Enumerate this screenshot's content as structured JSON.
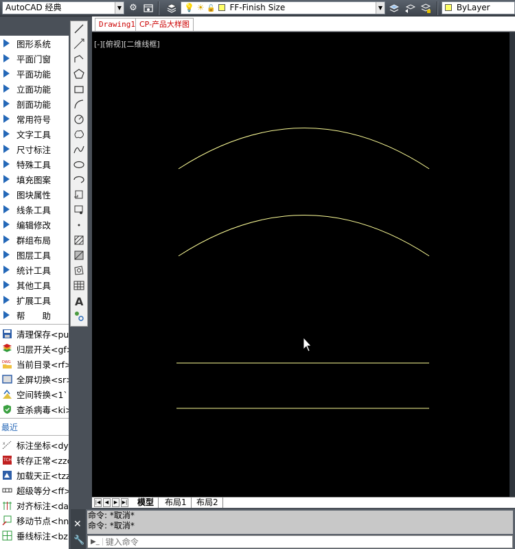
{
  "toolbar": {
    "workspace": "AutoCAD 经典",
    "layer": "FF-Finish Size",
    "color": "ByLayer",
    "icons": [
      "gear-icon",
      "workspace-icon",
      "layer-properties-icon",
      "lightbulb-icon",
      "sun-icon",
      "lock-icon",
      "make-current-layer-icon",
      "layer-previous-icon",
      "layer-state-icon"
    ]
  },
  "file_tabs": [
    {
      "label": "Drawing1",
      "active": false
    },
    {
      "label": "CP-产品大样图",
      "active": true
    }
  ],
  "viewport_label": "[-][俯视][二维线框]",
  "left_menu": [
    "图形系统",
    "平面门窗",
    "平面功能",
    "立面功能",
    "剖面功能",
    "常用符号",
    "文字工具",
    "尺寸标注",
    "特殊工具",
    "填充图案",
    "图块属性",
    "线条工具",
    "编辑修改",
    "群组布局",
    "图层工具",
    "统计工具",
    "其他工具",
    "扩展工具",
    "帮　　助"
  ],
  "tools_top": [
    {
      "label": "清理保存<pu>",
      "icon": "save-icon"
    },
    {
      "label": "归层开关<gf>",
      "icon": "layers-toggle-icon"
    },
    {
      "label": "当前目录<rf>",
      "icon": "dwg-folder-icon"
    },
    {
      "label": "全屏切换<sr>",
      "icon": "fullscreen-icon"
    },
    {
      "label": "空间转换<1`",
      "icon": "space-convert-icon"
    },
    {
      "label": "查杀病毒<ki>",
      "icon": "shield-icon"
    }
  ],
  "recent_label": "最近",
  "tools_recent": [
    {
      "label": "标注坐标<dy>",
      "icon": "coordinate-icon"
    },
    {
      "label": "转存正常<zzc",
      "icon": "convert-save-icon"
    },
    {
      "label": "加载天正<tzz",
      "icon": "load-tz-icon"
    },
    {
      "label": "超级等分<ff>",
      "icon": "divide-icon"
    },
    {
      "label": "对齐标注<da>",
      "icon": "align-dimension-icon"
    },
    {
      "label": "移动节点<hnn",
      "icon": "move-node-icon"
    },
    {
      "label": "垂线标注<bz>",
      "icon": "perpendicular-icon"
    }
  ],
  "draw_tools": [
    "line-icon",
    "construction-line-icon",
    "polyline-icon",
    "polygon-icon",
    "rectangle-icon",
    "arc-icon",
    "circle-icon",
    "revision-cloud-icon",
    "spline-icon",
    "ellipse-icon",
    "ellipse-arc-icon",
    "insert-block-icon",
    "make-block-icon",
    "point-icon",
    "hatch-icon",
    "gradient-icon",
    "region-icon",
    "table-icon",
    "multiline-text-icon",
    "add-selected-icon"
  ],
  "layout_tabs": [
    "模型",
    "布局1",
    "布局2"
  ],
  "active_layout": "模型",
  "command": {
    "history": [
      "命令: *取消*",
      "命令: *取消*"
    ],
    "placeholder": "键入命令"
  },
  "colors": {
    "canvas": "#000000",
    "geometry": "#ffff99",
    "accent": "#2468b8"
  }
}
